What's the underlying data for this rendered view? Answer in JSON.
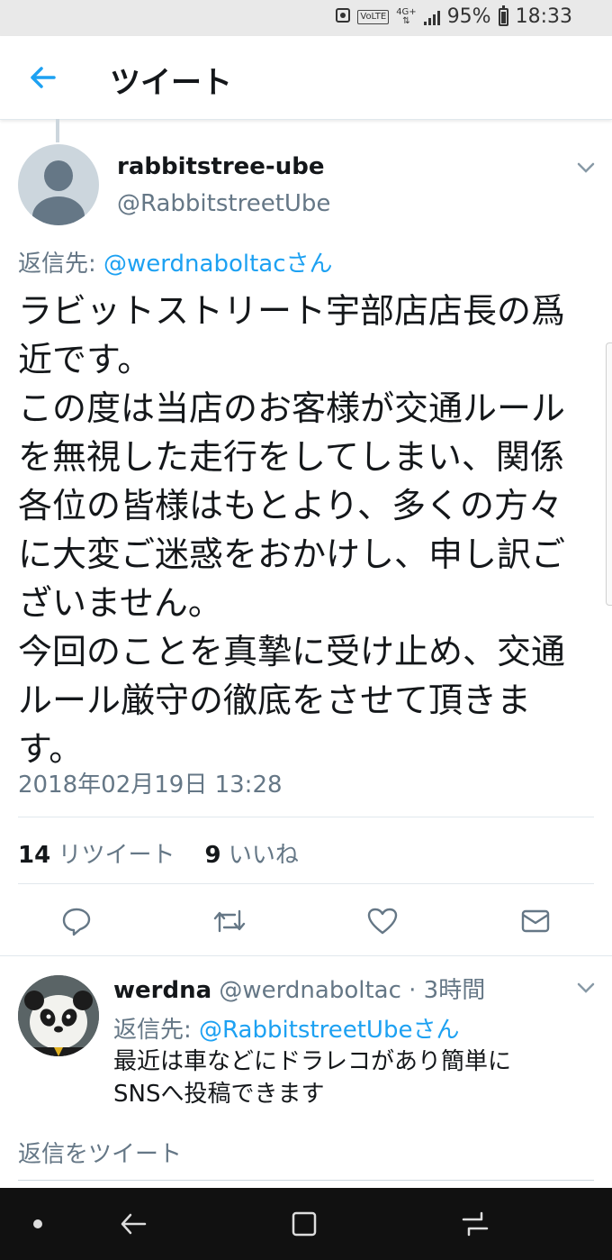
{
  "status_bar": {
    "battery": "95%",
    "time": "18:33",
    "network": "4G+",
    "volte": "VoLTE"
  },
  "app_bar": {
    "title": "ツイート"
  },
  "tweet": {
    "display_name": "rabbitstree-ube",
    "handle": "@RabbitstreetUbe",
    "reply_prefix": "返信先:",
    "reply_target": "@werdnaboltacさん",
    "text_lines": [
      "ラビットストリート宇部店店長の爲",
      "近です。",
      "この度は当店のお客様が交通ルール",
      "を無視した走行をしてしまい、関係",
      "各位の皆様はもとより、多くの方々",
      "に大変ご迷惑をおかけし、申し訳ご",
      "ざいません。",
      "今回のことを真摯に受け止め、交通",
      "ルール厳守の徹底をさせて頂きま",
      "す。"
    ],
    "timestamp": "2018年02月19日 13:28",
    "retweet_count": "14",
    "retweet_label": "リツイート",
    "like_count": "9",
    "like_label": "いいね"
  },
  "reply": {
    "display_name": "werdna",
    "handle": "@werdnaboltac",
    "time": "· 3時間",
    "reply_prefix": "返信先:",
    "reply_target": "@RabbitstreetUbeさん",
    "text_lines": [
      "最近は車などにドラレコがあり簡単に",
      "SNSへ投稿できます"
    ]
  },
  "compose": {
    "placeholder": "返信をツイート"
  },
  "colors": {
    "accent": "#1da1f2",
    "secondary_text": "#657786",
    "primary_text": "#14171a",
    "divider": "#e1e8ed"
  }
}
